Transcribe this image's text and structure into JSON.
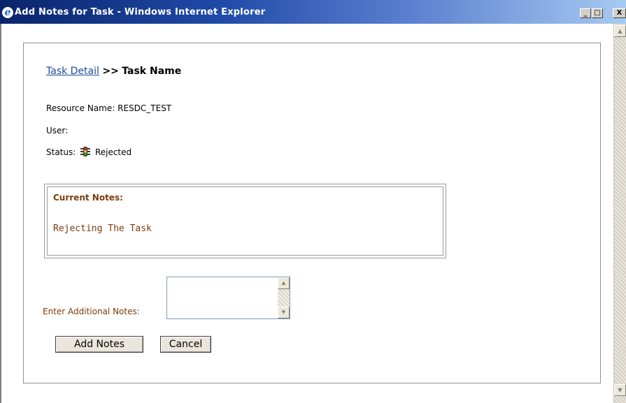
{
  "window": {
    "title": "Add Notes for Task - Windows Internet Explorer",
    "minimize_label": "_",
    "maximize_label": "□",
    "close_label": "X"
  },
  "breadcrumb": {
    "link_label": "Task Detail",
    "separator": ">>",
    "current": "Task Name"
  },
  "task": {
    "resource_label": "Resource Name:",
    "resource_value": "RESDC_TEST",
    "user_label": "User:",
    "user_value": "",
    "status_label": "Status:",
    "status_value": "Rejected",
    "status_icon": "traffic-light-icon"
  },
  "notes": {
    "current_label": "Current Notes:",
    "current_text": "Rejecting The Task",
    "additional_label": "Enter Additional Notes:",
    "additional_value": ""
  },
  "buttons": {
    "add_notes": "Add Notes",
    "cancel": "Cancel"
  },
  "colors": {
    "notes_text": "#7a3c0c",
    "link": "#1a4a9b",
    "titlebar": "#0a246a"
  }
}
